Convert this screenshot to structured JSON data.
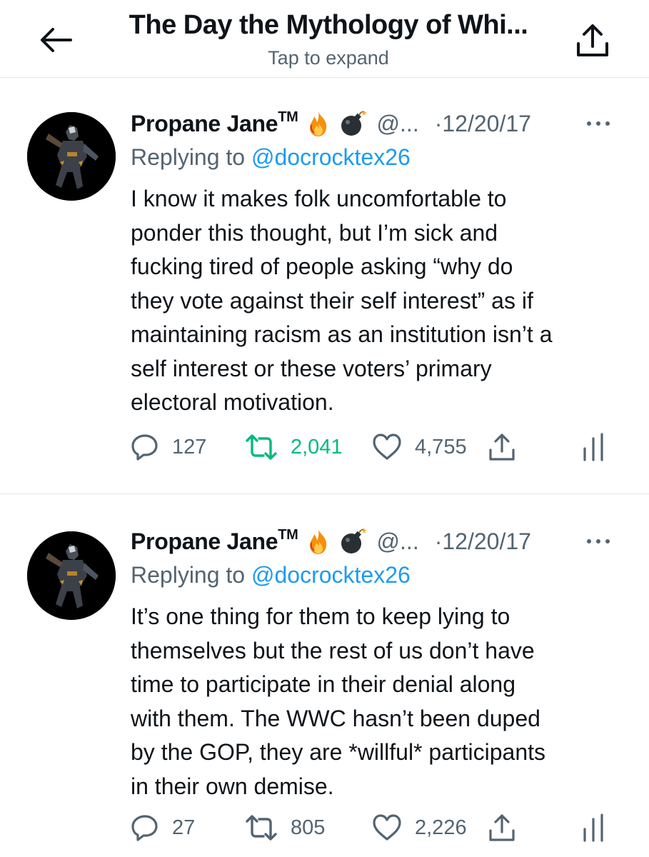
{
  "header": {
    "title": "The Day the Mythology of Whi...",
    "subtitle": "Tap to expand",
    "back_icon": "arrow-left-icon",
    "share_icon": "share-icon"
  },
  "colors": {
    "text": "#0f1419",
    "secondary": "#536471",
    "link": "#1d9bf0",
    "retweet_active": "#00ba7c",
    "divider": "#e6e8ea"
  },
  "tweets": [
    {
      "name": "Propane Jane",
      "tm": "TM",
      "emojis": [
        "fire-emoji",
        "bomb-emoji"
      ],
      "handle": "@...",
      "date": "·12/20/17",
      "replying_prefix": "Replying to ",
      "replying_to": "@docrocktex26",
      "text": "I know it makes folk uncomfortable to\nponder this thought, but I’m sick and\nfucking tired of people asking “why do\nthey vote against their self interest” as if\nmaintaining racism as an institution isn’t a\nself interest or these voters’ primary\nelectoral motivation.",
      "replies": "127",
      "retweets": "2,041",
      "retweeted": true,
      "likes": "4,755"
    },
    {
      "name": "Propane Jane",
      "tm": "TM",
      "emojis": [
        "fire-emoji",
        "bomb-emoji"
      ],
      "handle": "@...",
      "date": "·12/20/17",
      "replying_prefix": "Replying to ",
      "replying_to": "@docrocktex26",
      "text": "It’s one thing for them to keep lying to\nthemselves but the rest of us don’t have\ntime to participate in their denial along\nwith them. The WWC hasn’t been duped\nby the GOP, they are *willful* participants\nin their own demise.",
      "replies": "27",
      "retweets": "805",
      "retweeted": false,
      "likes": "2,226"
    }
  ]
}
